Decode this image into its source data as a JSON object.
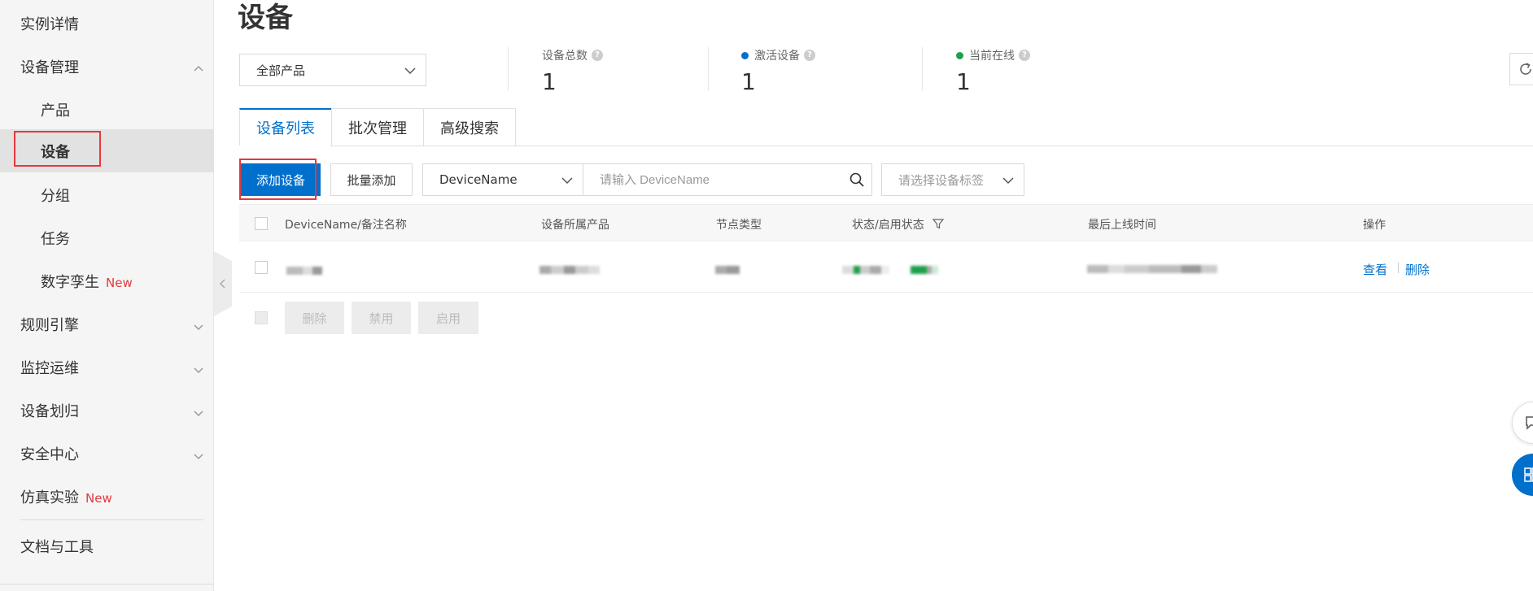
{
  "sidebar": {
    "items": [
      {
        "label": "实例详情"
      },
      {
        "label": "设备管理"
      },
      {
        "label": "产品"
      },
      {
        "label": "设备"
      },
      {
        "label": "分组"
      },
      {
        "label": "任务"
      },
      {
        "label": "数字孪生",
        "badge": "New"
      },
      {
        "label": "规则引擎"
      },
      {
        "label": "监控运维"
      },
      {
        "label": "设备划归"
      },
      {
        "label": "安全中心"
      },
      {
        "label": "仿真实验",
        "badge": "New"
      },
      {
        "label": "文档与工具"
      }
    ]
  },
  "page": {
    "title": "设备"
  },
  "product_filter": {
    "value": "全部产品"
  },
  "stats": {
    "total": {
      "label": "设备总数",
      "value": "1"
    },
    "activated": {
      "label": "激活设备",
      "value": "1",
      "dot_color": "#0070cc"
    },
    "online": {
      "label": "当前在线",
      "value": "1",
      "dot_color": "#1e9f4b"
    }
  },
  "tabs": [
    {
      "label": "设备列表",
      "active": true
    },
    {
      "label": "批次管理",
      "active": false
    },
    {
      "label": "高级搜索",
      "active": false
    }
  ],
  "toolbar": {
    "add_device": "添加设备",
    "batch_add": "批量添加",
    "search_type": "DeviceName",
    "search_placeholder": "请输入 DeviceName",
    "tag_placeholder": "请选择设备标签"
  },
  "table": {
    "columns": [
      "DeviceName/备注名称",
      "设备所属产品",
      "节点类型",
      "状态/启用状态",
      "最后上线时间",
      "操作"
    ],
    "row_actions": {
      "view": "查看",
      "delete": "删除"
    }
  },
  "bulk_actions": {
    "delete": "删除",
    "disable": "禁用",
    "enable": "启用"
  },
  "colors": {
    "primary": "#0070cc",
    "new_badge": "#e4393c",
    "highlight_box": "#e4393c"
  }
}
